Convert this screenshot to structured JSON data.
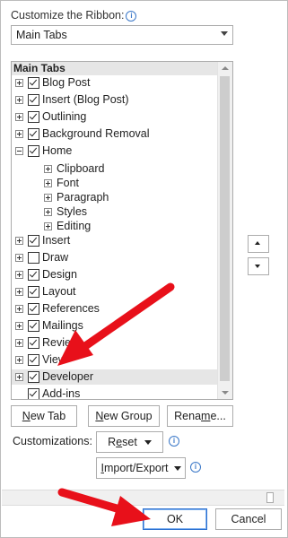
{
  "customize_label": "Customize the Ribbon:",
  "tabs_dropdown": {
    "value": "Main Tabs"
  },
  "tree": {
    "header": "Main Tabs",
    "items": [
      {
        "label": "Blog Post",
        "checked": true,
        "expand": "plus",
        "level": 0
      },
      {
        "label": "Insert (Blog Post)",
        "checked": true,
        "expand": "plus",
        "level": 0
      },
      {
        "label": "Outlining",
        "checked": true,
        "expand": "plus",
        "level": 0
      },
      {
        "label": "Background Removal",
        "checked": true,
        "expand": "plus",
        "level": 0
      },
      {
        "label": "Home",
        "checked": true,
        "expand": "minus",
        "level": 0
      },
      {
        "label": "Clipboard",
        "expand": "plus",
        "level": 1
      },
      {
        "label": "Font",
        "expand": "plus",
        "level": 1
      },
      {
        "label": "Paragraph",
        "expand": "plus",
        "level": 1
      },
      {
        "label": "Styles",
        "expand": "plus",
        "level": 1
      },
      {
        "label": "Editing",
        "expand": "plus",
        "level": 1
      },
      {
        "label": "Insert",
        "checked": true,
        "expand": "plus",
        "level": 0
      },
      {
        "label": "Draw",
        "checked": false,
        "expand": "plus",
        "level": 0
      },
      {
        "label": "Design",
        "checked": true,
        "expand": "plus",
        "level": 0
      },
      {
        "label": "Layout",
        "checked": true,
        "expand": "plus",
        "level": 0
      },
      {
        "label": "References",
        "checked": true,
        "expand": "plus",
        "level": 0
      },
      {
        "label": "Mailings",
        "checked": true,
        "expand": "plus",
        "level": 0
      },
      {
        "label": "Review",
        "checked": true,
        "expand": "plus",
        "level": 0
      },
      {
        "label": "View",
        "checked": true,
        "expand": "plus",
        "level": 0
      },
      {
        "label": "Developer",
        "checked": true,
        "expand": "plus",
        "level": 0,
        "selected": true
      },
      {
        "label": "Add-ins",
        "checked": true,
        "expand": "none",
        "level": 0
      }
    ]
  },
  "buttons": {
    "new_tab": {
      "u": "N",
      "rest": "ew Tab"
    },
    "new_group": {
      "u": "N",
      "rest": "ew Group"
    },
    "rename": {
      "pre": "Rena",
      "u": "m",
      "rest": "e..."
    },
    "customizations_label": "Customizations:",
    "reset": {
      "pre": "R",
      "u": "e",
      "rest": "set"
    },
    "import_export": {
      "u": "I",
      "rest": "mport/Export"
    },
    "ok": "OK",
    "cancel": "Cancel"
  },
  "colors": {
    "annotation_arrow": "#e8101a",
    "selected_row": "#e6e6e6",
    "info_icon": "#3b78c8"
  },
  "icons": [
    "info-icon",
    "dropdown-arrow-icon",
    "expand-plus-icon",
    "collapse-minus-icon",
    "checkbox-icon",
    "move-up-icon",
    "move-down-icon"
  ]
}
